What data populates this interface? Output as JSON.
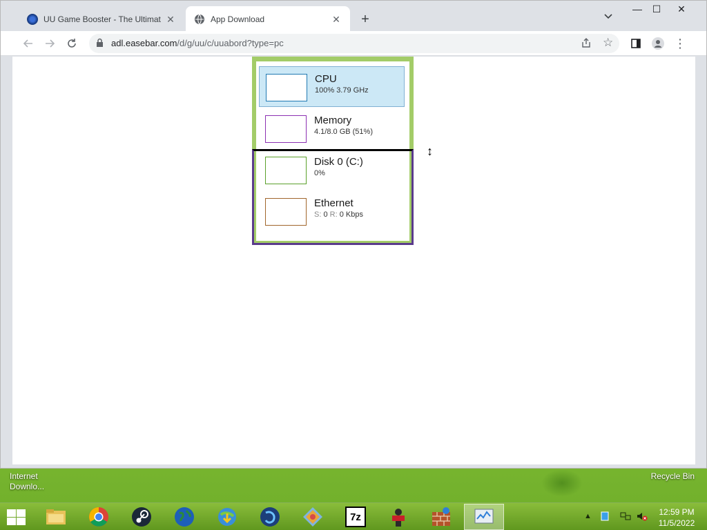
{
  "browser": {
    "tabs": [
      {
        "title": "UU Game Booster - The Ultimate",
        "active": false
      },
      {
        "title": "App Download",
        "active": true
      }
    ],
    "new_tab_label": "+",
    "tab_search_label": "⌄",
    "window_controls": {
      "minimize": "—",
      "maximize": "☐",
      "close": "✕"
    },
    "address_bar": {
      "domain": "adl.easebar.com",
      "path": "/d/g/uu/c/uuabord?type=pc"
    }
  },
  "performance": {
    "items": [
      {
        "name": "CPU",
        "value": "100%  3.79 GHz",
        "color": "#1f79b2",
        "selected": true
      },
      {
        "name": "Memory",
        "value": "4.1/8.0 GB (51%)",
        "color": "#8b2fb2",
        "selected": false
      },
      {
        "name": "Disk 0 (C:)",
        "value": "0%",
        "color": "#5aa02a",
        "selected": false
      },
      {
        "name": "Ethernet",
        "send_label": "S:",
        "send_value": "0",
        "recv_label": "R:",
        "recv_value": "0 Kbps",
        "color": "#a0652a",
        "selected": false
      }
    ]
  },
  "desktop": {
    "icons": [
      {
        "label": "Internet Downlo..."
      },
      {
        "label": "Recycle Bin"
      }
    ]
  },
  "taskbar": {
    "apps": [
      {
        "name": "file-explorer"
      },
      {
        "name": "chrome"
      },
      {
        "name": "steam"
      },
      {
        "name": "globe"
      },
      {
        "name": "internet-download-manager"
      },
      {
        "name": "app-blue"
      },
      {
        "name": "app-diamond"
      },
      {
        "name": "7zip",
        "label": "7z"
      },
      {
        "name": "game-app"
      },
      {
        "name": "firewall"
      },
      {
        "name": "task-manager",
        "active": true
      }
    ],
    "clock": {
      "time": "12:59 PM",
      "date": "11/5/2022"
    }
  }
}
